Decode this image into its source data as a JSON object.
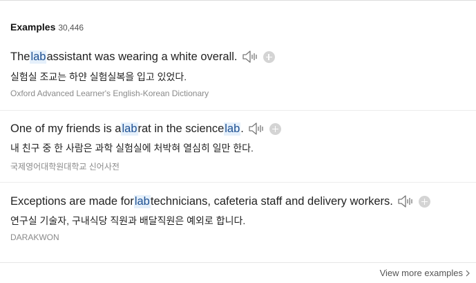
{
  "section": {
    "title": "Examples",
    "count": "30,446"
  },
  "examples": [
    {
      "parts": [
        "The ",
        "lab",
        " assistant was wearing a white overall."
      ],
      "translation": "실험실 조교는 하얀 실험실복을 입고 있었다.",
      "source": "Oxford Advanced Learner's English-Korean Dictionary"
    },
    {
      "parts": [
        "One of my friends is a ",
        "lab",
        " rat in the science ",
        "lab",
        "."
      ],
      "translation": "내 친구 중 한 사람은 과학 실험실에 처박혀 열심히 일만 한다.",
      "source": "국제영어대학원대학교 신어사전"
    },
    {
      "parts": [
        "Exceptions are made for ",
        "lab",
        " technicians, cafeteria staff and delivery workers."
      ],
      "translation": "연구실 기술자, 구내식당 직원과 배달직원은 예외로 합니다.",
      "source": "DARAKWON"
    }
  ],
  "footer": {
    "view_more_label": "View more examples"
  },
  "colors": {
    "highlight_bg": "#e5f0fb",
    "source_text": "#8a8a8a",
    "plus_button": "#d4d4d4"
  }
}
